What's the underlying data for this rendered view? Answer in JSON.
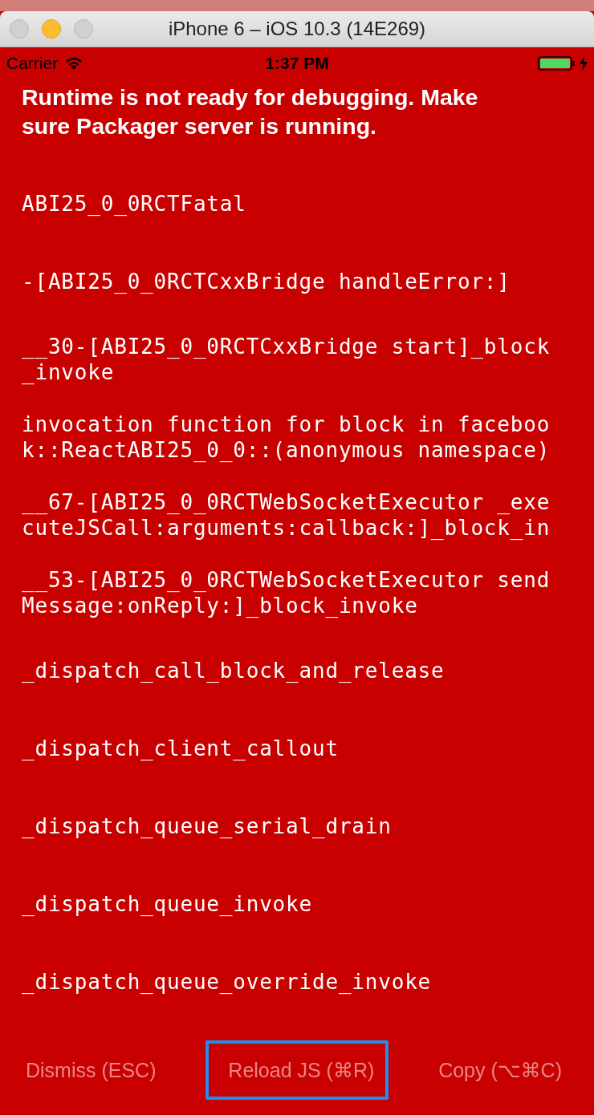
{
  "window": {
    "title": "iPhone 6 – iOS 10.3 (14E269)"
  },
  "status_bar": {
    "carrier": "Carrier",
    "time": "1:37 PM",
    "charging": true
  },
  "error": {
    "message": "Runtime is not ready for debugging. Make sure Packager server is running.",
    "stack": [
      "ABI25_0_0RCTFatal",
      "-[ABI25_0_0RCTCxxBridge handleError:]",
      "__30-[ABI25_0_0RCTCxxBridge start]_block_invoke",
      "invocation function for block in facebook::ReactABI25_0_0::(anonymous namespace)",
      "__67-[ABI25_0_0RCTWebSocketExecutor _executeJSCall:arguments:callback:]_block_in",
      "__53-[ABI25_0_0RCTWebSocketExecutor sendMessage:onReply:]_block_invoke",
      "_dispatch_call_block_and_release",
      "_dispatch_client_callout",
      "_dispatch_queue_serial_drain",
      "_dispatch_queue_invoke",
      "_dispatch_queue_override_invoke"
    ]
  },
  "buttons": [
    {
      "label": "Dismiss (ESC)",
      "selected": false
    },
    {
      "label": "Reload JS (⌘R)",
      "selected": true
    },
    {
      "label": "Copy (⌥⌘C)",
      "selected": false
    }
  ]
}
